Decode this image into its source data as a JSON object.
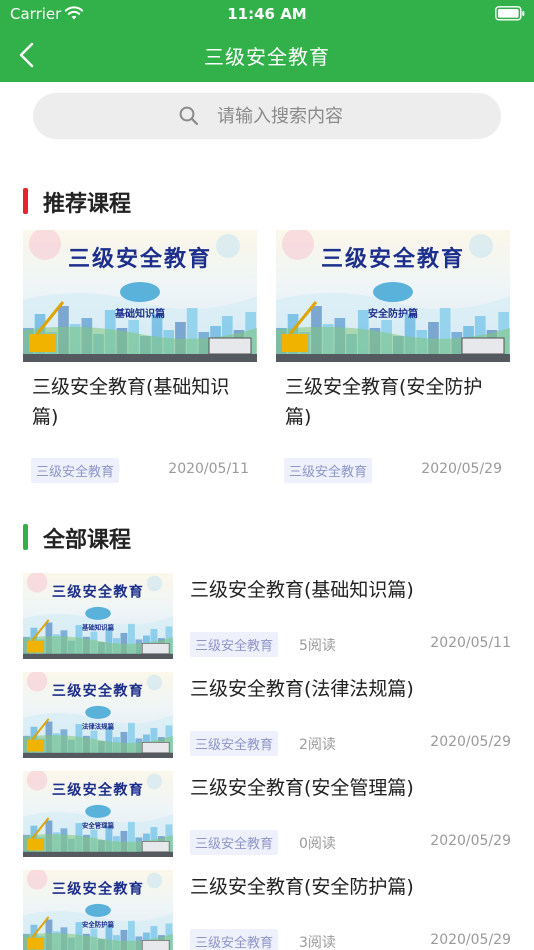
{
  "status_bar": {
    "carrier": "Carrier",
    "time": "11:46 AM"
  },
  "nav": {
    "title": "三级安全教育"
  },
  "search": {
    "placeholder": "请输入搜索内容"
  },
  "sections": {
    "recommended": {
      "title": "推荐课程",
      "accent": "#e8242c"
    },
    "all": {
      "title": "全部课程",
      "accent": "#32b14a"
    }
  },
  "theme": {
    "primary": "#32b14a",
    "tag_bg": "#eef0fc",
    "tag_text": "#8e96c8"
  },
  "thumb_heading": "三级安全教育",
  "recommended": [
    {
      "title": "三级安全教育(基础知识篇)",
      "tag": "三级安全教育",
      "date": "2020/05/11",
      "banner": "基础知识篇"
    },
    {
      "title": "三级安全教育(安全防护篇)",
      "tag": "三级安全教育",
      "date": "2020/05/29",
      "banner": "安全防护篇"
    }
  ],
  "courses": [
    {
      "title": "三级安全教育(基础知识篇)",
      "tag": "三级安全教育",
      "reads": "5阅读",
      "date": "2020/05/11",
      "banner": "基础知识篇"
    },
    {
      "title": "三级安全教育(法律法规篇)",
      "tag": "三级安全教育",
      "reads": "2阅读",
      "date": "2020/05/29",
      "banner": "法律法规篇"
    },
    {
      "title": "三级安全教育(安全管理篇)",
      "tag": "三级安全教育",
      "reads": "0阅读",
      "date": "2020/05/29",
      "banner": "安全管理篇"
    },
    {
      "title": "三级安全教育(安全防护篇)",
      "tag": "三级安全教育",
      "reads": "3阅读",
      "date": "2020/05/29",
      "banner": "安全防护篇"
    }
  ]
}
